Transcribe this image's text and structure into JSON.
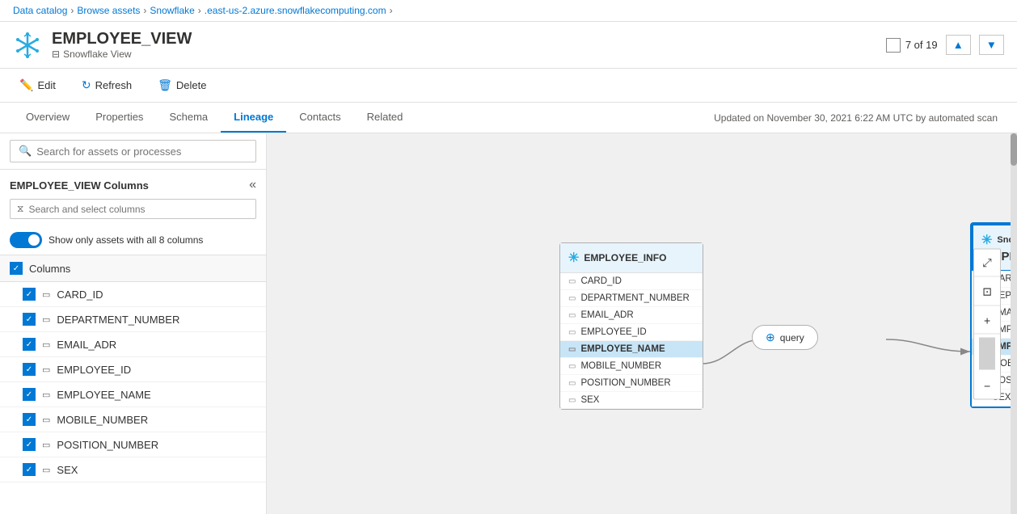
{
  "breadcrumb": {
    "items": [
      "Data catalog",
      "Browse assets",
      "Snowflake",
      ".east-us-2.azure.snowflakecomputing.com"
    ]
  },
  "header": {
    "title": "EMPLOYEE_VIEW",
    "subtitle": "Snowflake View",
    "counter": "7 of 19"
  },
  "toolbar": {
    "edit_label": "Edit",
    "refresh_label": "Refresh",
    "delete_label": "Delete"
  },
  "tabs": {
    "items": [
      "Overview",
      "Properties",
      "Schema",
      "Lineage",
      "Contacts",
      "Related"
    ],
    "active": "Lineage",
    "updated": "Updated on November 30, 2021 6:22 AM UTC by automated scan"
  },
  "search_assets": {
    "placeholder": "Search for assets or processes"
  },
  "columns_panel": {
    "title": "EMPLOYEE_VIEW Columns",
    "search_placeholder": "Search and select columns",
    "toggle_label": "Show only assets with all 8 columns",
    "all_label": "Columns",
    "columns": [
      {
        "name": "CARD_ID",
        "highlighted": false
      },
      {
        "name": "DEPARTMENT_NUMBER",
        "highlighted": false
      },
      {
        "name": "EMAIL_ADR",
        "highlighted": false
      },
      {
        "name": "EMPLOYEE_ID",
        "highlighted": false
      },
      {
        "name": "EMPLOYEE_NAME",
        "highlighted": false
      },
      {
        "name": "MOBILE_NUMBER",
        "highlighted": false
      },
      {
        "name": "POSITION_NUMBER",
        "highlighted": false
      },
      {
        "name": "SEX",
        "highlighted": false
      }
    ]
  },
  "lineage": {
    "source_node": {
      "title": "EMPLOYEE_INFO",
      "columns": [
        "CARD_ID",
        "DEPARTMENT_NUMBER",
        "EMAIL_ADR",
        "EMPLOYEE_ID",
        "EMPLOYEE_NAME",
        "MOBILE_NUMBER",
        "POSITION_NUMBER",
        "SEX"
      ],
      "highlighted_col": "EMPLOYEE_NAME"
    },
    "query_node": {
      "label": "query"
    },
    "target_node": {
      "subtitle": "Snowflake View",
      "title": "EMPLOYEE_VIEW",
      "columns": [
        "CARD_ID",
        "DEPARTMENT_NUMBER",
        "EMAIL_ADR",
        "EMPLOYEE_ID",
        "EMPLOYEE_NAME",
        "MOBILE_NUMBER",
        "POSITION_NUMBER",
        "SEX"
      ],
      "highlighted_col": "EMPLOYEE_NAME"
    }
  },
  "zoom_buttons": {
    "expand": "⤢",
    "fit": "⊡",
    "plus": "+",
    "minus": "−"
  }
}
